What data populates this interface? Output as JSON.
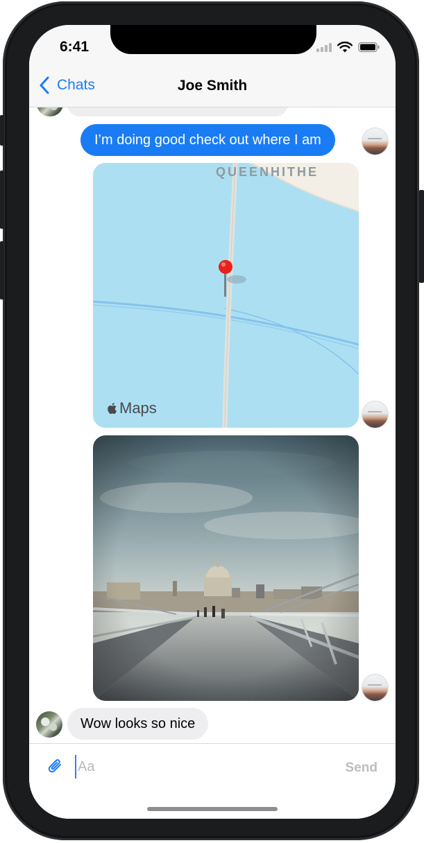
{
  "status_bar": {
    "time": "6:41"
  },
  "nav": {
    "back_label": "Chats",
    "title": "Joe Smith"
  },
  "messages": [
    {
      "direction": "incoming",
      "type": "text",
      "text": ""
    },
    {
      "direction": "outgoing",
      "type": "text",
      "text": "I’m doing good check out where I am"
    },
    {
      "direction": "outgoing",
      "type": "map",
      "map_label": "QUEENHITHE",
      "brand": "Maps"
    },
    {
      "direction": "outgoing",
      "type": "photo"
    },
    {
      "direction": "incoming",
      "type": "text",
      "text": "Wow looks so nice"
    }
  ],
  "composer": {
    "placeholder": "Aa",
    "value": "",
    "send_label": "Send"
  },
  "colors": {
    "accent": "#1a7cf5",
    "outgoing_bubble": "#1a7cf5",
    "incoming_bubble": "#eeeef0",
    "map_water": "#acdff2",
    "pin": "#e8211b"
  },
  "icons": {
    "back": "chevron-left-icon",
    "attach": "paperclip-icon",
    "map_pin": "map-pin-icon",
    "maps_logo": "apple-logo-icon",
    "wifi": "wifi-icon",
    "battery": "battery-icon",
    "signal": "cellular-signal-icon"
  }
}
